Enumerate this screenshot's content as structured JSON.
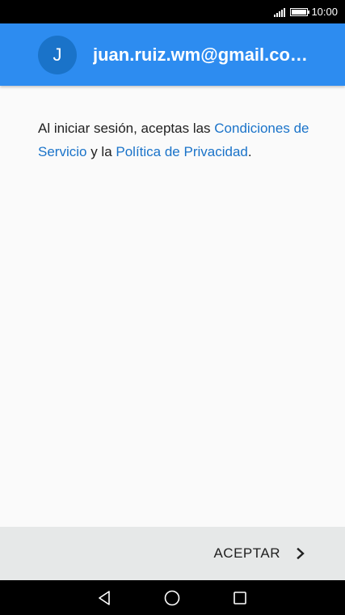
{
  "status_bar": {
    "time": "10:00",
    "icons": [
      "signal-icon",
      "battery-icon"
    ]
  },
  "account": {
    "avatar_letter": "J",
    "email": "juan.ruiz.wm@gmail.co…"
  },
  "content": {
    "text_before": "Al iniciar sesión, aceptas las ",
    "terms_link": "Condiciones de Servicio",
    "text_middle": " y la ",
    "privacy_link": "Política de Privacidad",
    "text_after": "."
  },
  "actions": {
    "accept_label": "ACEPTAR"
  },
  "nav": {
    "icons": [
      "back-icon",
      "home-icon",
      "recents-icon"
    ]
  },
  "colors": {
    "app_bar": "#2d8cf0",
    "avatar": "#1a73c9",
    "link": "#1a73c9",
    "action_bar": "#e6e8e8"
  }
}
